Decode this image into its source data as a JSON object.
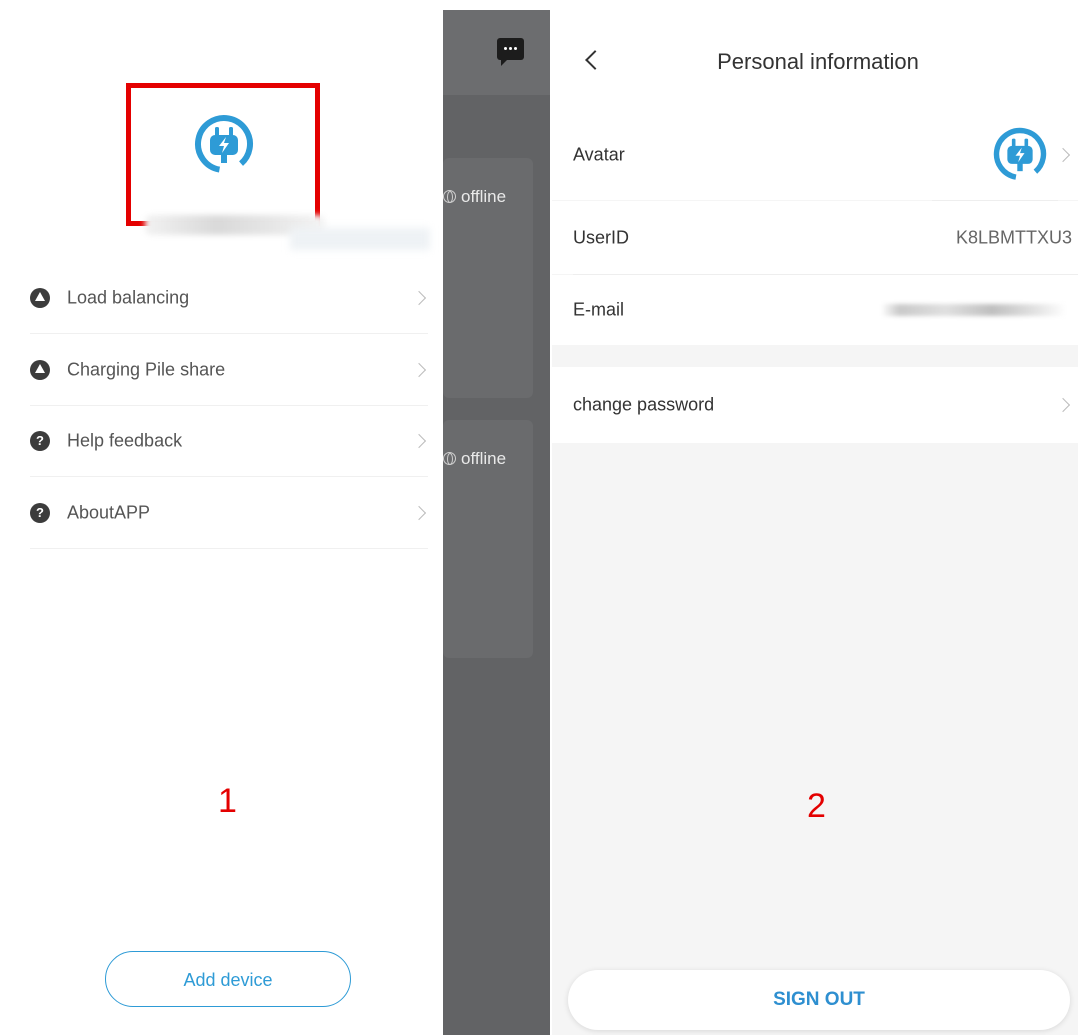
{
  "drawer": {
    "menu": [
      {
        "label": "Load balancing",
        "icon": "A"
      },
      {
        "label": "Charging Pile share",
        "icon": "A"
      },
      {
        "label": "Help feedback",
        "icon": "?"
      },
      {
        "label": "AboutAPP",
        "icon": "?"
      }
    ],
    "annotation_number": "1",
    "add_device_label": "Add device"
  },
  "background_list": {
    "statuses": [
      "offline",
      "offline"
    ]
  },
  "personal_info": {
    "title": "Personal information",
    "avatar_label": "Avatar",
    "userid_label": "UserID",
    "userid_value": "K8LBMTTXU3",
    "email_label": "E-mail",
    "change_password_label": "change password",
    "annotation_number": "2",
    "sign_out_label": "SIGN OUT"
  },
  "colors": {
    "accent": "#2e9bd6",
    "highlight": "#e40000"
  }
}
